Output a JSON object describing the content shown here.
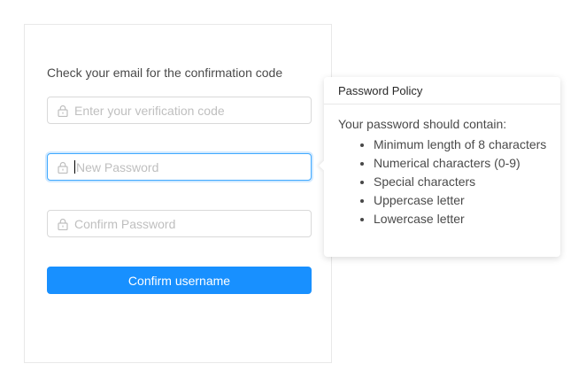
{
  "form": {
    "message": "Check your email for the confirmation code",
    "code_field": {
      "placeholder": "Enter your verification code",
      "icon": "lock-icon"
    },
    "new_password_field": {
      "placeholder": "New Password",
      "icon": "lock-icon",
      "focused": true
    },
    "confirm_password_field": {
      "placeholder": "Confirm Password",
      "icon": "lock-icon"
    },
    "submit_label": "Confirm username"
  },
  "popover": {
    "title": "Password Policy",
    "heading": "Your password should contain:",
    "items": [
      "Minimum length of 8 characters",
      "Numerical characters (0-9)",
      "Special characters",
      "Uppercase letter",
      "Lowercase letter"
    ]
  },
  "colors": {
    "primary": "#1890ff",
    "focus_border": "#40a9ff",
    "border": "#d9d9d9",
    "placeholder": "#bfbfbf"
  }
}
